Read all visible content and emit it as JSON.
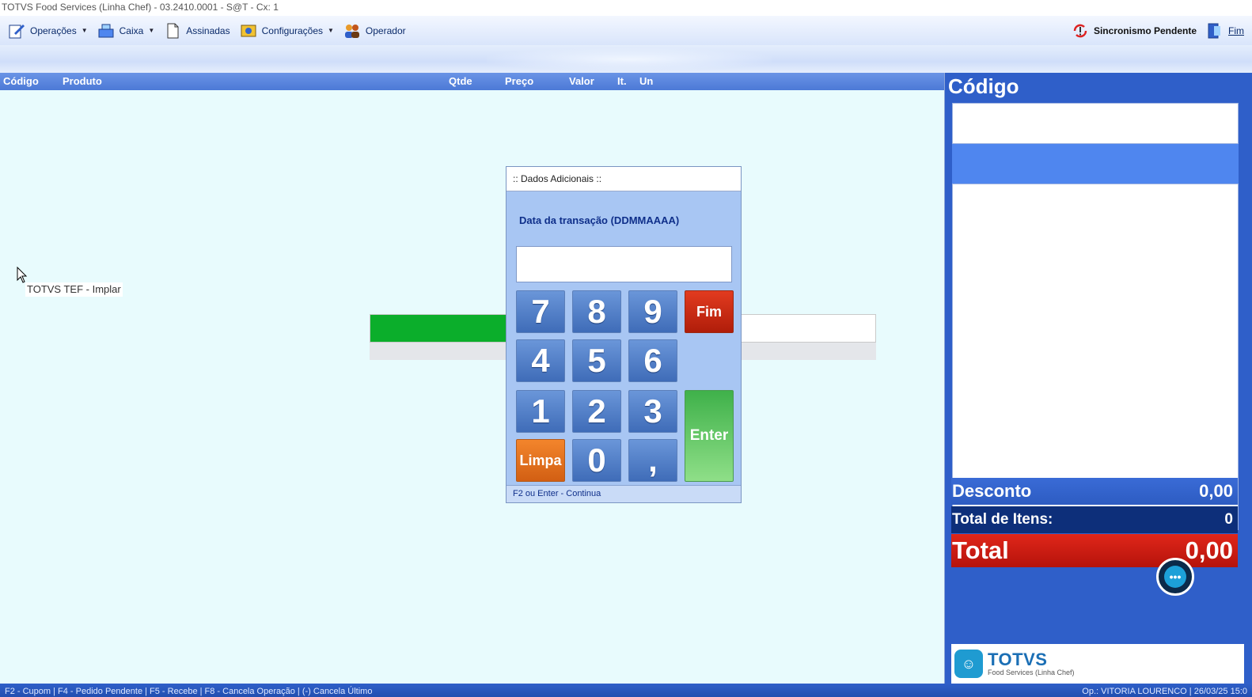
{
  "window": {
    "title": "TOTVS Food Services (Linha Chef) - 03.2410.0001 - S@T - Cx: 1"
  },
  "menu": {
    "items": [
      {
        "label": "Operações",
        "icon": "edit-icon",
        "dropdown": true
      },
      {
        "label": "Caixa",
        "icon": "cash-register-icon",
        "dropdown": true
      },
      {
        "label": "Assinadas",
        "icon": "document-icon",
        "dropdown": false
      },
      {
        "label": "Configurações",
        "icon": "settings-icon",
        "dropdown": true
      },
      {
        "label": "Operador",
        "icon": "users-icon",
        "dropdown": false
      }
    ],
    "sync_label": "Sincronismo Pendente",
    "exit_label": "Fim"
  },
  "grid": {
    "columns": [
      "Código",
      "Produto",
      "Qtde",
      "Preço",
      "Valor",
      "It.",
      "Un"
    ]
  },
  "tooltip": {
    "label": "TOTVS TEF - Implar"
  },
  "progress": {
    "fraction": 0.27,
    "color": "#0bae2b"
  },
  "dialog": {
    "title": ":: Dados Adicionais ::",
    "prompt": "Data da transação (DDMMAAAA)",
    "input_value": "",
    "keys": {
      "k7": "7",
      "k8": "8",
      "k9": "9",
      "k4": "4",
      "k5": "5",
      "k6": "6",
      "k1": "1",
      "k2": "2",
      "k3": "3",
      "k0": "0",
      "comma": ",",
      "fim": "Fim",
      "limpa": "Limpa",
      "enter": "Enter"
    },
    "footer": "F2 ou Enter - Continua"
  },
  "right_panel": {
    "code_label": "Código",
    "code_value": "",
    "desconto_label": "Desconto",
    "desconto_value": "0,00",
    "itens_label": "Total de Itens:",
    "itens_value": "0",
    "total_label": "Total",
    "total_value": "0,00",
    "logo_main": "TOTVS",
    "logo_sub": "Food Services (Linha Chef)"
  },
  "statusbar": {
    "left": "F2 - Cupom | F4 - Pedido Pendente | F5 - Recebe | F8 - Cancela Operação | (-) Cancela Último",
    "right": "Op.: VITORIA LOURENCO | 26/03/25 15:0"
  },
  "colors": {
    "accent": "#2f5fc9",
    "total_red": "#d01f14",
    "enter_green": "#3fb14a",
    "fim_red": "#c52a12",
    "limpa_orange": "#e5701f"
  }
}
